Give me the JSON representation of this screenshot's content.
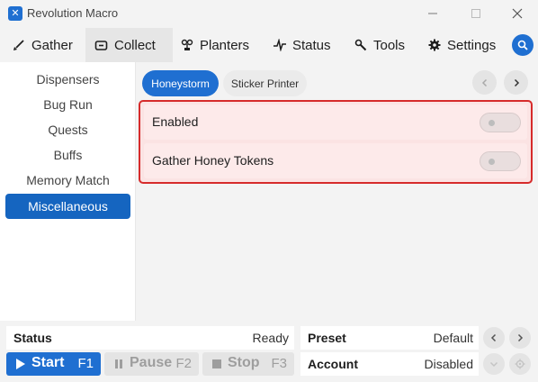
{
  "window": {
    "title": "Revolution Macro",
    "app_icon_glyph": "✕"
  },
  "tabs": [
    {
      "label": "Gather",
      "icon": "shovel-icon"
    },
    {
      "label": "Collect",
      "icon": "collect-icon"
    },
    {
      "label": "Planters",
      "icon": "plant-icon"
    },
    {
      "label": "Status",
      "icon": "pulse-icon"
    },
    {
      "label": "Tools",
      "icon": "wrench-icon"
    },
    {
      "label": "Settings",
      "icon": "gear-icon"
    }
  ],
  "active_tab": "Collect",
  "sidebar": {
    "items": [
      {
        "label": "Dispensers"
      },
      {
        "label": "Bug Run"
      },
      {
        "label": "Quests"
      },
      {
        "label": "Buffs"
      },
      {
        "label": "Memory Match"
      },
      {
        "label": "Miscellaneous"
      }
    ],
    "active": "Miscellaneous"
  },
  "subtabs": [
    {
      "label": "Honeystorm"
    },
    {
      "label": "Sticker Printer"
    }
  ],
  "active_subtab": "Honeystorm",
  "settings": [
    {
      "label": "Enabled",
      "enabled": false
    },
    {
      "label": "Gather Honey Tokens",
      "enabled": false
    }
  ],
  "bottom": {
    "status_label": "Status",
    "status_value": "Ready",
    "start_label": "Start",
    "start_key": "F1",
    "pause_label": "Pause",
    "pause_key": "F2",
    "stop_label": "Stop",
    "stop_key": "F3",
    "preset_label": "Preset",
    "preset_value": "Default",
    "account_label": "Account",
    "account_value": "Disabled"
  },
  "colors": {
    "accent": "#1f6fd1",
    "highlight_border": "#d62b2b",
    "highlight_bg": "#fbe3e3"
  }
}
